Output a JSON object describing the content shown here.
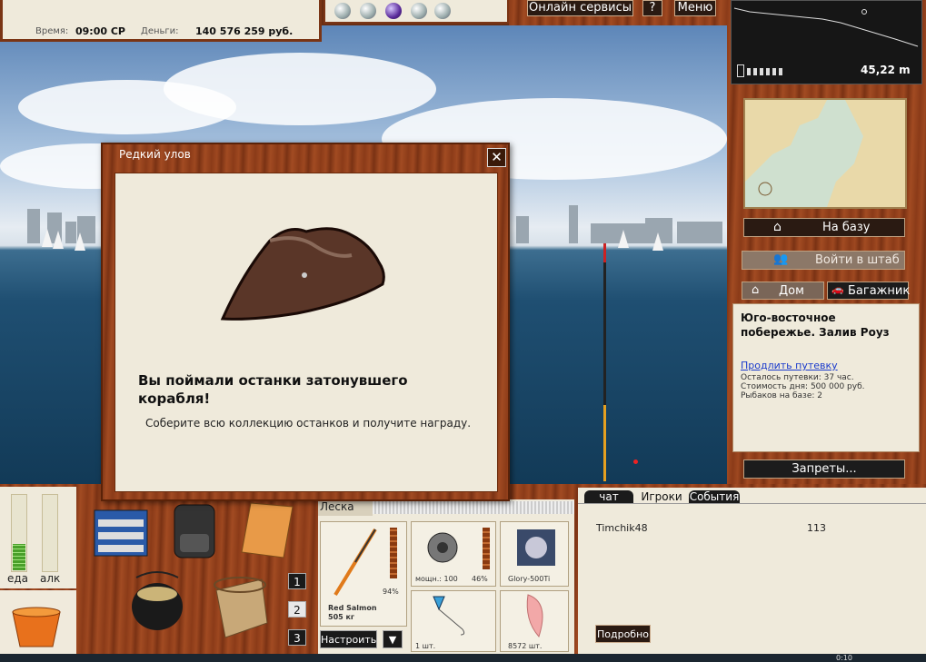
{
  "stats": {
    "time_label": "Время:",
    "time_value": "09:00 СР",
    "money_label": "Деньги:",
    "money_value": "140 576 259 руб."
  },
  "top_buttons": {
    "online": "Онлайн сервисы",
    "help": "?",
    "menu": "Меню"
  },
  "depth": {
    "value": "45,22 m"
  },
  "right": {
    "to_base": "На базу",
    "to_hq": "Войти в штаб",
    "home": "Дом",
    "trunk": "Багажник",
    "bans": "Запреты..."
  },
  "location": {
    "title": "Юго-восточное побережье. Залив Роуз",
    "extend_link": "Продлить путевку",
    "remaining": "Осталось путевки: 37 час.",
    "day_cost": "Стоимость дня: 500 000 руб.",
    "fishermen": "Рыбаков на базе: 2"
  },
  "dialog": {
    "title": "Редкий улов",
    "close": "✕",
    "headline": "Вы поймали останки затонувшего корабля!",
    "text": "Соберите всю коллекцию останков и получите награду."
  },
  "needs": {
    "food": "еда",
    "alco": "алк",
    "food_level": 0.35,
    "alco_level": 0.0
  },
  "inventory": {
    "slots": [
      "1",
      "2",
      "3"
    ]
  },
  "tackle": {
    "line_label": "Леска",
    "rod_name": "Red Salmon",
    "rod_weight": "505 кг",
    "rod_percent": "94%",
    "reel_power": "мощн.: 100",
    "reel_percent": "46%",
    "line_name": "Glory-500Ti",
    "hook_count": "1 шт.",
    "bait_count": "8572 шт.",
    "setup": "Настроить",
    "dropdown": "▼"
  },
  "chat": {
    "tabs": [
      "чат",
      "Игроки",
      "События"
    ],
    "player_name": "Timchik48",
    "player_value": "113",
    "details": "Подробно"
  },
  "status": {
    "clock": "0:10"
  }
}
